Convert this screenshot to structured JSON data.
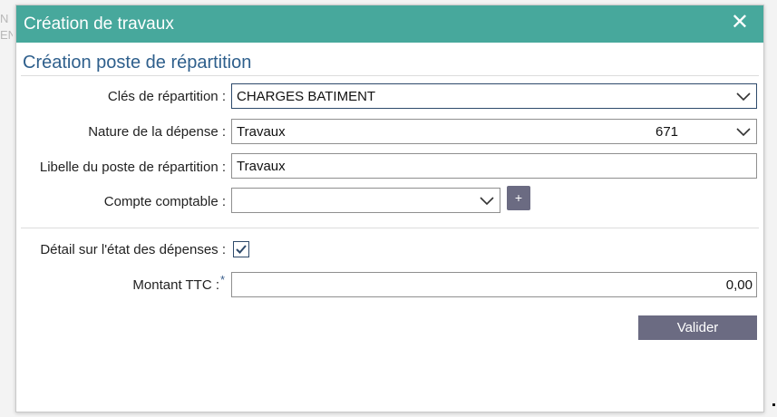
{
  "background": {
    "hint_text": "N\nEN"
  },
  "dialog": {
    "title": "Création de travaux",
    "close_icon": "close-icon",
    "section_title": "Création poste de répartition",
    "accent_color": "#47a89c",
    "button_color": "#6b6b82"
  },
  "form": {
    "cles": {
      "label": "Clés de répartition :",
      "value": "CHARGES BATIMENT"
    },
    "nature": {
      "label": "Nature de la dépense :",
      "value": "Travaux",
      "code": "671"
    },
    "libelle": {
      "label": "Libelle du poste de répartition :",
      "value": "Travaux"
    },
    "compte": {
      "label": "Compte comptable :",
      "value": "",
      "add_label": "+"
    },
    "detail": {
      "label": "Détail sur l'état des dépenses :",
      "checked": true
    },
    "montant": {
      "label": "Montant TTC :",
      "required_mark": "*",
      "value": "0,00"
    }
  },
  "actions": {
    "valider_label": "Valider"
  }
}
